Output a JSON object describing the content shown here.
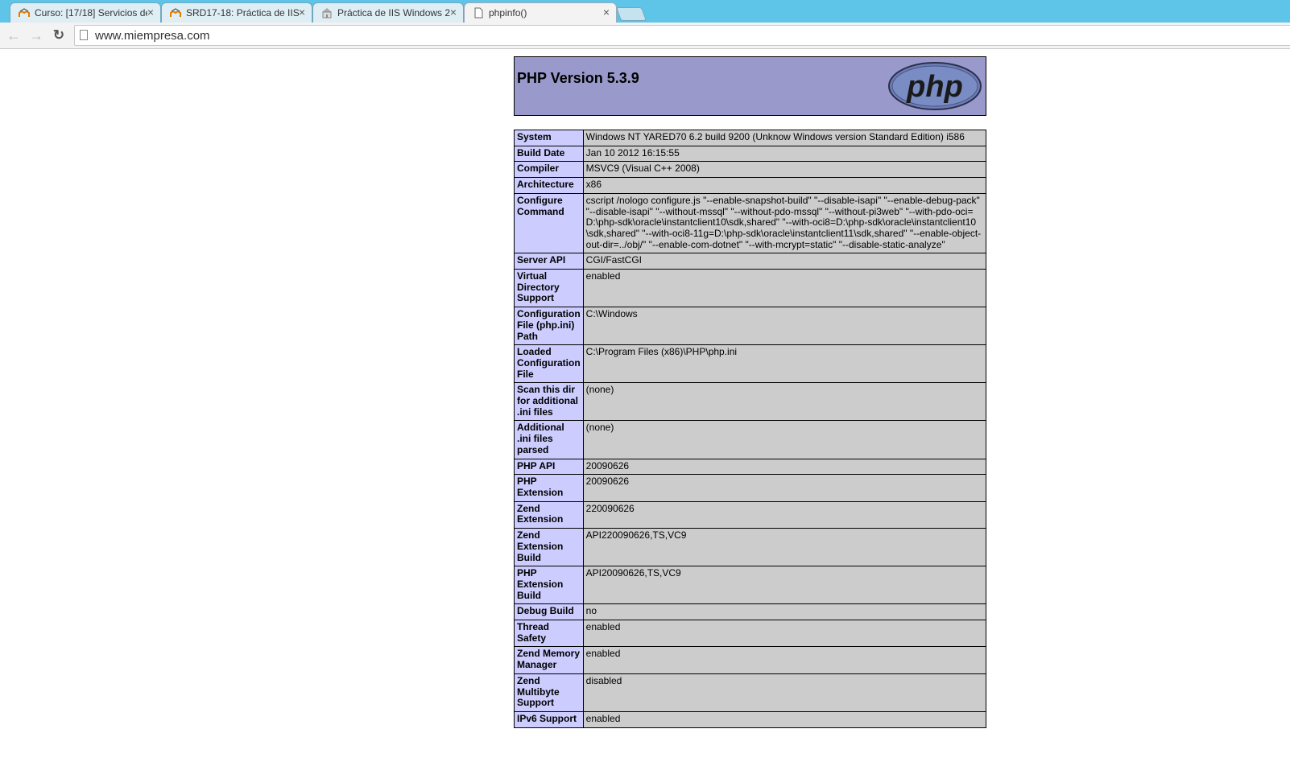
{
  "browser": {
    "tabs": [
      {
        "title": "Curso: [17/18] Servicios de",
        "icon": "moodle-icon",
        "active": false
      },
      {
        "title": "SRD17-18: Práctica de IIS",
        "icon": "moodle-icon",
        "active": false
      },
      {
        "title": "Práctica de IIS Windows 2",
        "icon": "building-icon",
        "active": false
      },
      {
        "title": "phpinfo()",
        "icon": "page-icon",
        "active": true
      }
    ],
    "close_glyph": "×",
    "url": "www.miempresa.com",
    "back_glyph": "←",
    "forward_glyph": "→",
    "reload_glyph": "↻"
  },
  "page": {
    "title": "PHP Version 5.3.9",
    "logo_text": "php",
    "header_color": "#9999cc",
    "key_color": "#ccccff",
    "value_color": "#cccccc",
    "rows": [
      {
        "key": "System",
        "value": "Windows NT YARED70 6.2 build 9200 (Unknow Windows version Standard Edition) i586"
      },
      {
        "key": "Build Date",
        "value": "Jan 10 2012 16:15:55"
      },
      {
        "key": "Compiler",
        "value": "MSVC9 (Visual C++ 2008)"
      },
      {
        "key": "Architecture",
        "value": "x86"
      },
      {
        "key": "Configure Command",
        "value": "cscript /nologo configure.js \"--enable-snapshot-build\" \"--disable-isapi\" \"--enable-debug-pack\" \"--disable-isapi\" \"--without-mssql\" \"--without-pdo-mssql\" \"--without-pi3web\" \"--with-pdo-oci=D:\\php-sdk\\oracle\\instantclient10\\sdk,shared\" \"--with-oci8=D:\\php-sdk\\oracle\\instantclient10\\sdk,shared\" \"--with-oci8-11g=D:\\php-sdk\\oracle\\instantclient11\\sdk,shared\" \"--enable-object-out-dir=../obj/\" \"--enable-com-dotnet\" \"--with-mcrypt=static\" \"--disable-static-analyze\""
      },
      {
        "key": "Server API",
        "value": "CGI/FastCGI"
      },
      {
        "key": "Virtual Directory Support",
        "value": "enabled"
      },
      {
        "key": "Configuration File (php.ini) Path",
        "value": "C:\\Windows"
      },
      {
        "key": "Loaded Configuration File",
        "value": "C:\\Program Files (x86)\\PHP\\php.ini"
      },
      {
        "key": "Scan this dir for additional .ini files",
        "value": "(none)"
      },
      {
        "key": "Additional .ini files parsed",
        "value": "(none)"
      },
      {
        "key": "PHP API",
        "value": "20090626"
      },
      {
        "key": "PHP Extension",
        "value": "20090626"
      },
      {
        "key": "Zend Extension",
        "value": "220090626"
      },
      {
        "key": "Zend Extension Build",
        "value": "API220090626,TS,VC9"
      },
      {
        "key": "PHP Extension Build",
        "value": "API20090626,TS,VC9"
      },
      {
        "key": "Debug Build",
        "value": "no"
      },
      {
        "key": "Thread Safety",
        "value": "enabled"
      },
      {
        "key": "Zend Memory Manager",
        "value": "enabled"
      },
      {
        "key": "Zend Multibyte Support",
        "value": "disabled"
      },
      {
        "key": "IPv6 Support",
        "value": "enabled"
      }
    ]
  }
}
